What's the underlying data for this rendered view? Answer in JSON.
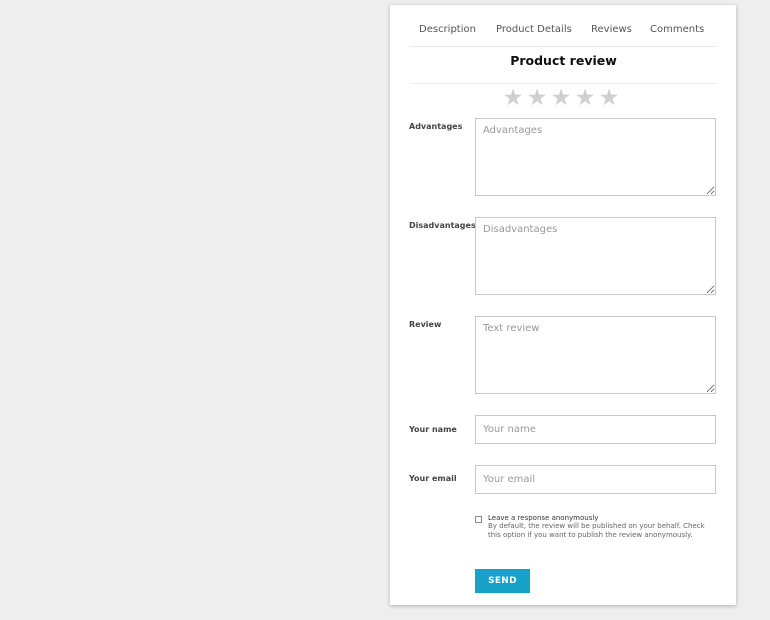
{
  "tabs": [
    {
      "label": "Description"
    },
    {
      "label": "Product Details"
    },
    {
      "label": "Reviews"
    },
    {
      "label": "Comments"
    }
  ],
  "form": {
    "title": "Product review",
    "rating": {
      "max": 5,
      "value": 0,
      "icon": "star-icon",
      "inactive_color": "#cfcfcf"
    },
    "advantages": {
      "label": "Advantages",
      "placeholder": "Advantages"
    },
    "disadvantages": {
      "label": "Disadvantages",
      "placeholder": "Disadvantages"
    },
    "review": {
      "label": "Review",
      "placeholder": "Text review"
    },
    "name": {
      "label": "Your name",
      "placeholder": "Your name"
    },
    "email": {
      "label": "Your email",
      "placeholder": "Your email"
    },
    "anonymous": {
      "title": "Leave a response anonymously",
      "description": "By default, the review will be published on your behalf. Check this option if you want to publish the review anonymously.",
      "checked": false
    },
    "send_label": "SEND",
    "accent_color": "#17a2c9"
  }
}
